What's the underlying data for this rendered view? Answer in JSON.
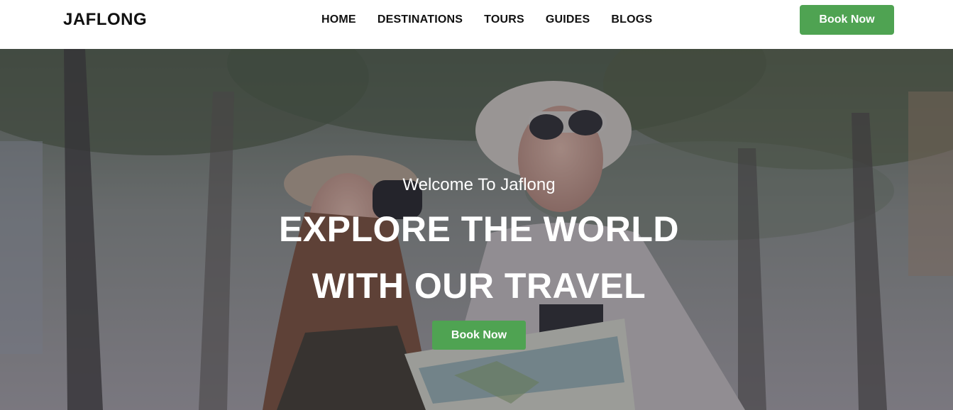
{
  "header": {
    "logo": "JAFLONG",
    "nav": [
      {
        "label": "HOME"
      },
      {
        "label": "DESTINATIONS"
      },
      {
        "label": "TOURS"
      },
      {
        "label": "GUIDES"
      },
      {
        "label": "BLOGS"
      }
    ],
    "book_button": "Book Now"
  },
  "hero": {
    "welcome": "Welcome To Jaflong",
    "title_line1": "EXPLORE THE WORLD",
    "title_line2": "WITH OUR TRAVEL",
    "book_button": "Book Now",
    "image_subject": "travel-couple-photo"
  },
  "colors": {
    "accent_green": "#4fa352",
    "nav_text": "#111111",
    "hero_text": "#ffffff"
  }
}
